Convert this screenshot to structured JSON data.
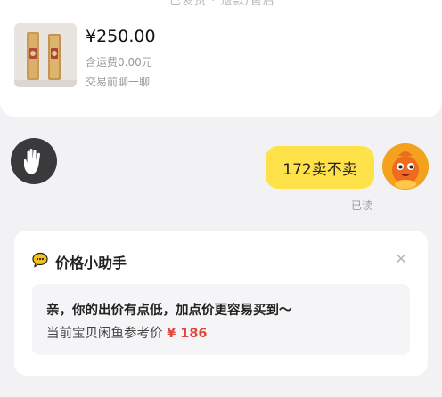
{
  "header": {
    "cut_off_text": "已发货 · 退款/售后"
  },
  "product": {
    "price": "¥250.00",
    "shipping": "含运费0.00元",
    "chat_hint": "交易前聊一聊",
    "thumbnail_icon": "lipstick-image"
  },
  "chat": {
    "left_icon": "hand-icon",
    "message": "172卖不卖",
    "read_status": "已读",
    "avatar_icon": "orange-mascot-avatar"
  },
  "price_helper": {
    "icon": "chat-bubble-icon",
    "title": "价格小助手",
    "close_icon": "close-icon",
    "close_glyph": "×",
    "tip_line1": "亲，你的出价有点低，加点价更容易买到～",
    "tip_line2_prefix": "当前宝贝闲鱼参考价",
    "reference_price": "¥ 186"
  },
  "colors": {
    "bubble": "#ffe24a",
    "accent_price": "#e2473b",
    "avatar": "#f4a21e"
  }
}
